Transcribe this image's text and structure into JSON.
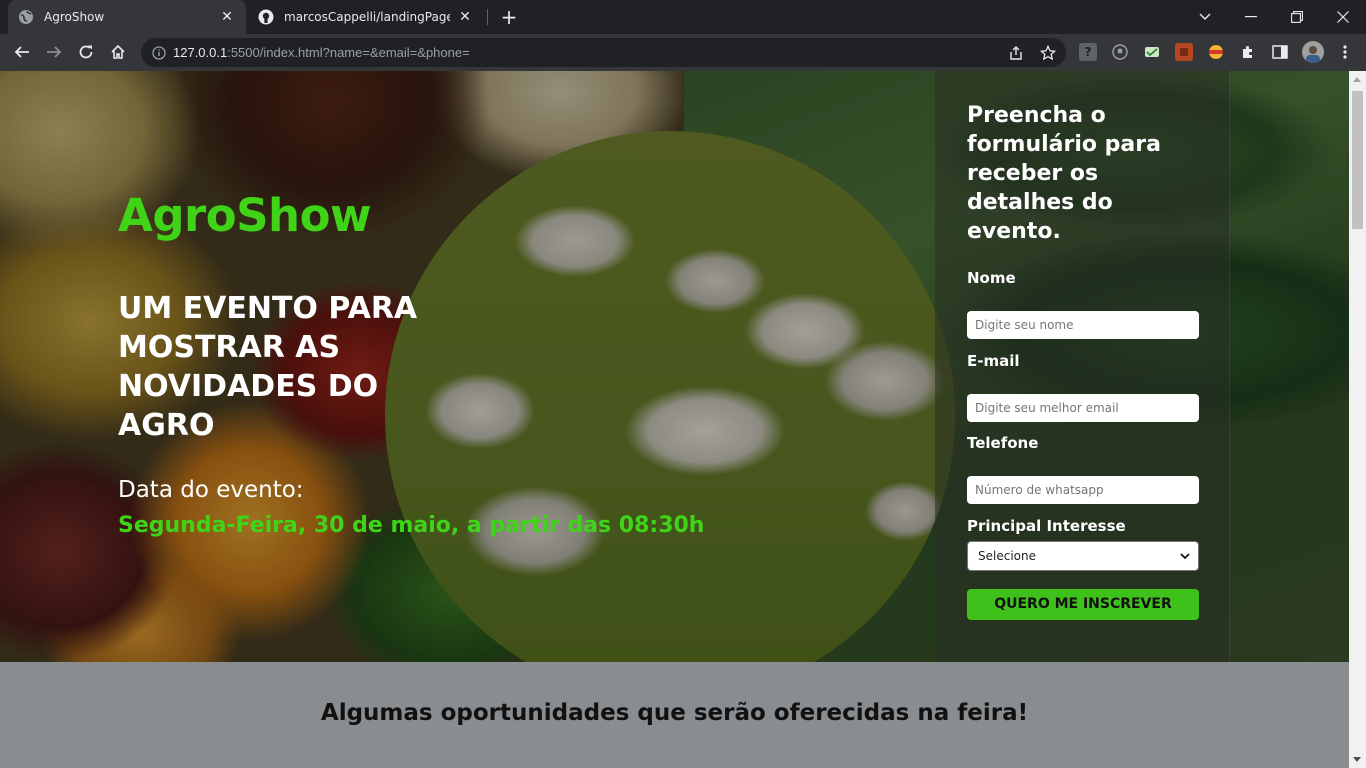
{
  "browser": {
    "tabs": [
      {
        "title": "AgroShow",
        "icon": "globe-icon"
      },
      {
        "title": "marcosCappelli/landingPage at m",
        "icon": "github-icon"
      }
    ],
    "url_host": "127.0.0.1",
    "url_rest": ":5500/index.html?name=&email=&phone=",
    "new_tab": "+",
    "window_controls": {
      "dropdown": "⌄",
      "minimize": "—",
      "restore": "❐",
      "close": "✕"
    }
  },
  "hero": {
    "brand": "AgroShow",
    "headline": "UM EVENTO PARA MOSTRAR AS NOVIDADES DO AGRO",
    "date_label": "Data do evento:",
    "date_value": "Segunda-Feira, 30 de maio, a partir das 08:30h"
  },
  "form": {
    "title": "Preencha o formulário para receber os detalhes do evento.",
    "name_label": "Nome",
    "name_placeholder": "Digite seu nome",
    "email_label": "E-mail",
    "email_placeholder": "Digite seu melhor email",
    "phone_label": "Telefone",
    "phone_placeholder": "Número de whatsapp",
    "interest_label": "Principal Interesse",
    "interest_selected": "Selecione",
    "submit_label": "QUERO ME INSCREVER"
  },
  "section2": {
    "title": "Algumas oportunidades que serão oferecidas na feira!"
  },
  "colors": {
    "brand_green": "#3fd418",
    "button_green": "#3fc11b",
    "chrome_dark": "#202124",
    "chrome_toolbar": "#35363a"
  }
}
